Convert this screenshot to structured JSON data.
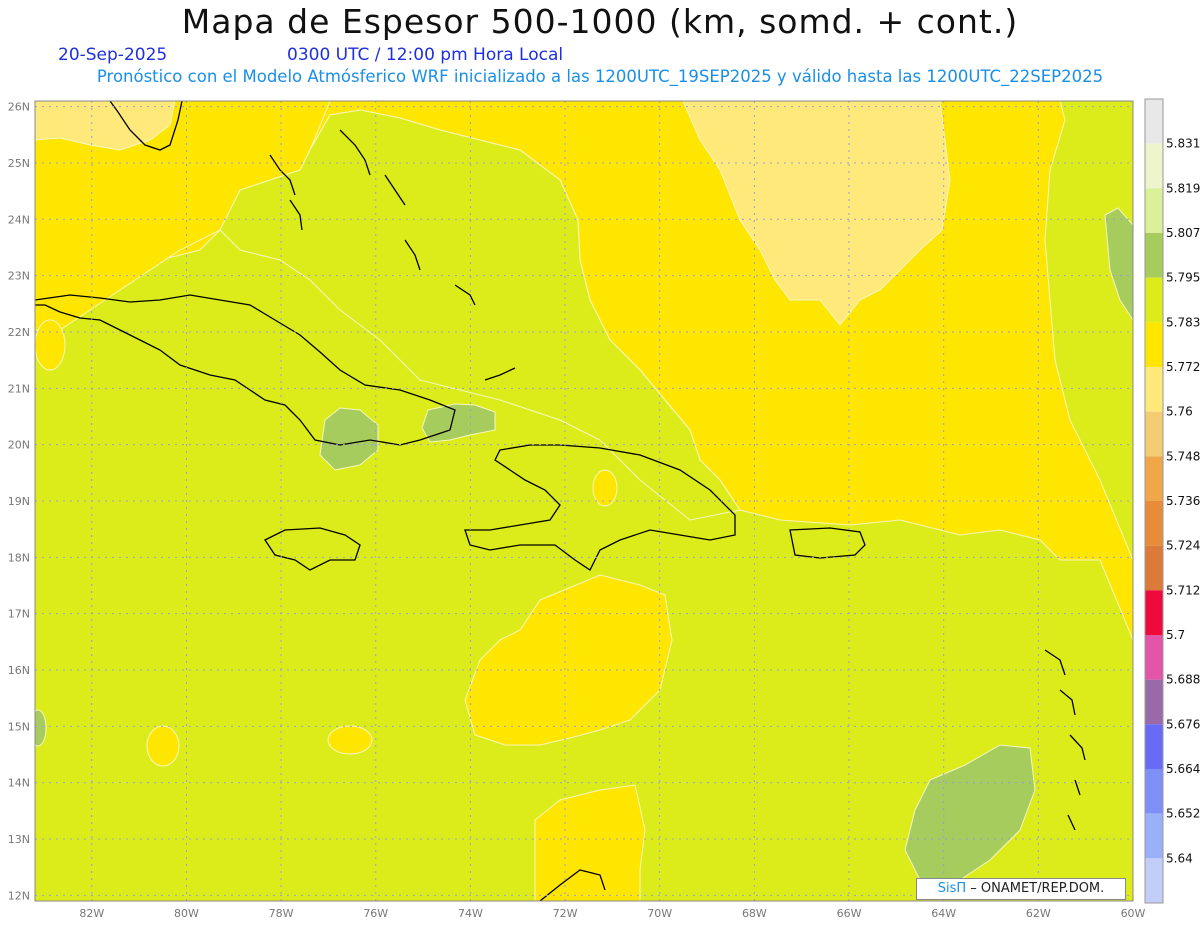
{
  "header": {
    "title": "Mapa de Espesor 500-1000 (km, somd. + cont.)",
    "date": "20-Sep-2025",
    "time": "0300 UTC / 12:00 pm Hora Local",
    "forecast_info": "Pronóstico con el Modelo Atmósferico WRF inicializado a las 1200UTC_19SEP2025 y válido hasta las  1200UTC_22SEP2025"
  },
  "map": {
    "region": "Caribbean",
    "lon_range": [
      -83.2,
      -60
    ],
    "lat_range": [
      11.9,
      26.1
    ],
    "lon_ticks": [
      "82W",
      "80W",
      "78W",
      "76W",
      "74W",
      "72W",
      "70W",
      "68W",
      "66W",
      "64W",
      "62W",
      "60W"
    ],
    "lat_ticks": [
      "26N",
      "25N",
      "24N",
      "23N",
      "22N",
      "21N",
      "20N",
      "19N",
      "18N",
      "17N",
      "16N",
      "15N",
      "14N",
      "13N",
      "12N"
    ],
    "grid": true
  },
  "colorbar": {
    "labels": [
      "5.831",
      "5.819",
      "5.807",
      "5.795",
      "5.783",
      "5.772",
      "5.76",
      "5.748",
      "5.736",
      "5.724",
      "5.712",
      "5.7",
      "5.688",
      "5.676",
      "5.664",
      "5.652",
      "5.64"
    ],
    "colors": [
      "#e8e8e8",
      "#eef5cc",
      "#dcf09a",
      "#a7cc5e",
      "#dcec1a",
      "#ffe600",
      "#ffe97a",
      "#f4cc74",
      "#efa74a",
      "#e88c3a",
      "#dc7a3a",
      "#ef0a3c",
      "#e355a8",
      "#9a6aa8",
      "#6a6af8",
      "#7f8ff8",
      "#9ab0f8",
      "#c2cdf8"
    ]
  },
  "credit": {
    "brand": "SisΠ",
    "text": "– ONAMET/REP.DOM."
  }
}
